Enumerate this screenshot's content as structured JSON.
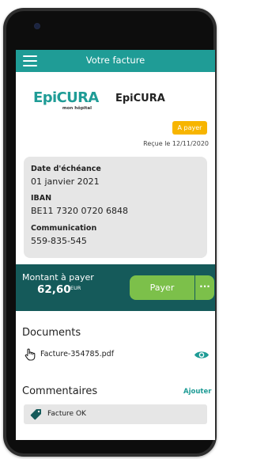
{
  "header": {
    "title": "Votre facture"
  },
  "provider": {
    "logo_main": "EpiCURA",
    "logo_sub": "mon hôpital",
    "name": "EpiCURA"
  },
  "invoice": {
    "status": "A payer",
    "received": "Reçue le 12/11/2020"
  },
  "details": {
    "due_label": "Date d'échéance",
    "due_value": "01 janvier 2021",
    "iban_label": "IBAN",
    "iban_value": "BE11 7320 0720 6848",
    "communication_label": "Communication",
    "communication_value": "559-835-545"
  },
  "payment": {
    "amount_label": "Montant à payer",
    "amount_value": "62,60",
    "currency": "EUR",
    "pay_label": "Payer",
    "more_label": "···"
  },
  "documents": {
    "title": "Documents",
    "items": [
      {
        "name": "Facture-354785.pdf",
        "icon": "hand-pointer-icon",
        "action_icon": "eye-icon"
      }
    ]
  },
  "comments": {
    "title": "Commentaires",
    "add_label": "Ajouter",
    "items": [
      {
        "text": "Facture OK",
        "icon": "tag-icon"
      }
    ]
  },
  "colors": {
    "primary": "#1f9c96",
    "pay_bar": "#155a5a",
    "pay_button": "#7cc04a",
    "badge": "#f7b500",
    "card": "#e6e6e6"
  }
}
